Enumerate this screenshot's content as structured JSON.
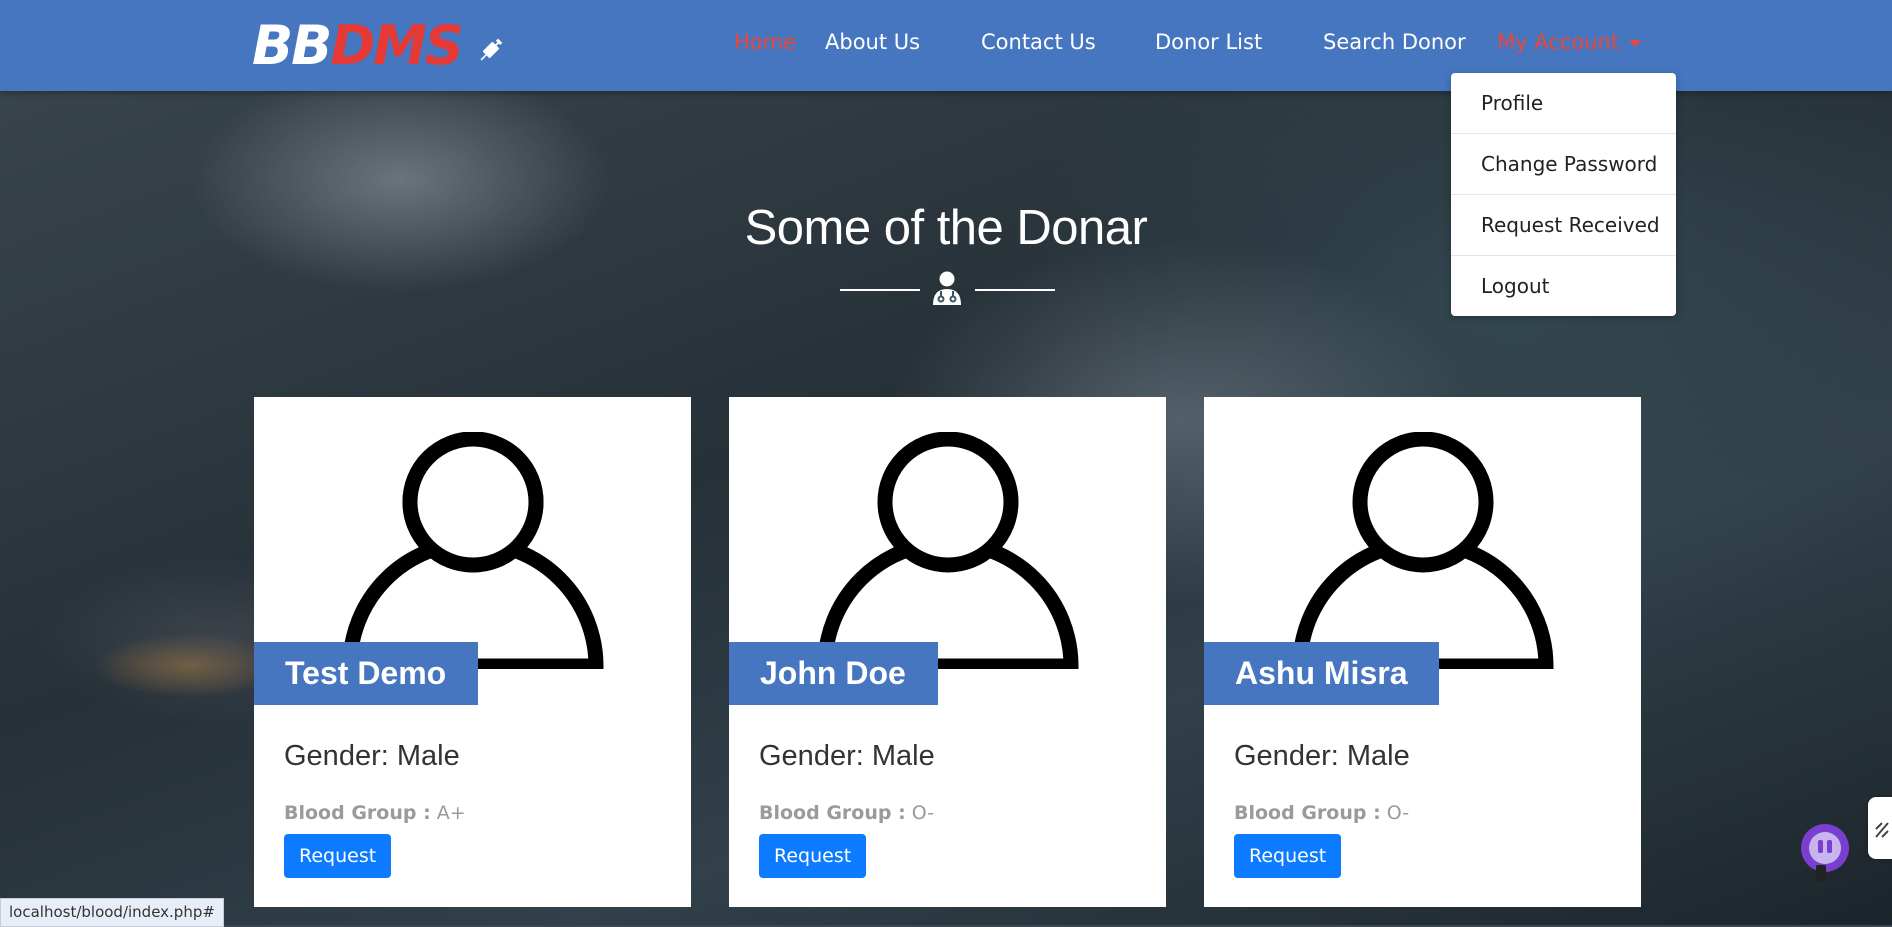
{
  "brand": {
    "part1": "BB",
    "part2": "DMS",
    "icon": "syringe-icon"
  },
  "nav": {
    "home": "Home",
    "about": "About Us",
    "contact": "Contact Us",
    "donor_list": "Donor List",
    "search": "Search Donor",
    "account": "My Account"
  },
  "dropdown": [
    "Profile",
    "Change Password",
    "Request Received",
    "Logout"
  ],
  "section": {
    "title": "Some of the Donar",
    "icon": "doctor-icon"
  },
  "donors": [
    {
      "name": "Test Demo",
      "gender": "Gender: Male",
      "blood_label": "Blood Group :",
      "blood": "A+",
      "button": "Request"
    },
    {
      "name": "John Doe",
      "gender": "Gender: Male",
      "blood_label": "Blood Group :",
      "blood": "O-",
      "button": "Request"
    },
    {
      "name": "Ashu Misra",
      "gender": "Gender: Male",
      "blood_label": "Blood Group :",
      "blood": "O-",
      "button": "Request"
    }
  ],
  "status_url": "localhost/blood/index.php#",
  "colors": {
    "navbar": "#4676c0",
    "accent_red": "#e8473b",
    "button": "#0d7bff"
  }
}
